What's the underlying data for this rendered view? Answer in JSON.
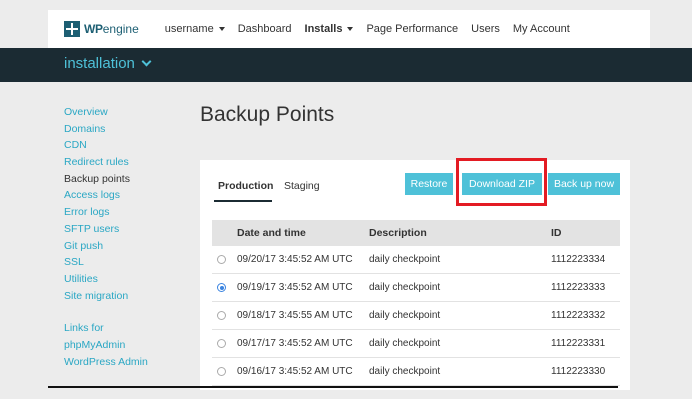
{
  "brand": {
    "wp": "WP",
    "engine": "engine"
  },
  "topnav": {
    "items": [
      {
        "label": "username",
        "dropdown": true,
        "active": false
      },
      {
        "label": "Dashboard",
        "dropdown": false,
        "active": false
      },
      {
        "label": "Installs",
        "dropdown": true,
        "active": true
      },
      {
        "label": "Page Performance",
        "dropdown": false,
        "active": false
      },
      {
        "label": "Users",
        "dropdown": false,
        "active": false
      },
      {
        "label": "My Account",
        "dropdown": false,
        "active": false
      }
    ]
  },
  "install_bar": {
    "title": "installation"
  },
  "sidebar": {
    "items": [
      {
        "label": "Overview"
      },
      {
        "label": "Domains"
      },
      {
        "label": "CDN"
      },
      {
        "label": "Redirect rules"
      },
      {
        "label": "Backup points",
        "current": true
      },
      {
        "label": "Access logs"
      },
      {
        "label": "Error logs"
      },
      {
        "label": "SFTP users"
      },
      {
        "label": "Git push"
      },
      {
        "label": "SSL"
      },
      {
        "label": "Utilities"
      },
      {
        "label": "Site migration"
      }
    ],
    "links_heading": "Links for",
    "links": [
      {
        "label": "phpMyAdmin"
      },
      {
        "label": "WordPress Admin"
      }
    ]
  },
  "page": {
    "title": "Backup Points"
  },
  "tabs": {
    "production": "Production",
    "staging": "Staging"
  },
  "buttons": {
    "restore": "Restore",
    "download_zip": "Download ZIP",
    "backup_now": "Back up now"
  },
  "table": {
    "headers": {
      "date": "Date and time",
      "description": "Description",
      "id": "ID"
    },
    "rows": [
      {
        "date": "09/20/17 3:45:52 AM UTC",
        "description": "daily checkpoint",
        "id": "1112223334",
        "selected": false
      },
      {
        "date": "09/19/17 3:45:52 AM UTC",
        "description": "daily checkpoint",
        "id": "1112223333",
        "selected": true
      },
      {
        "date": "09/18/17 3:45:55 AM UTC",
        "description": "daily checkpoint",
        "id": "1112223332",
        "selected": false
      },
      {
        "date": "09/17/17 3:45:52 AM UTC",
        "description": "daily checkpoint",
        "id": "1112223331",
        "selected": false
      },
      {
        "date": "09/16/17 3:45:52 AM UTC",
        "description": "daily checkpoint",
        "id": "1112223330",
        "selected": false
      }
    ]
  },
  "colors": {
    "accent": "#4ec1d8",
    "dark_bar": "#1b2b33",
    "highlight": "#e31b23",
    "link": "#2aa7c4"
  }
}
